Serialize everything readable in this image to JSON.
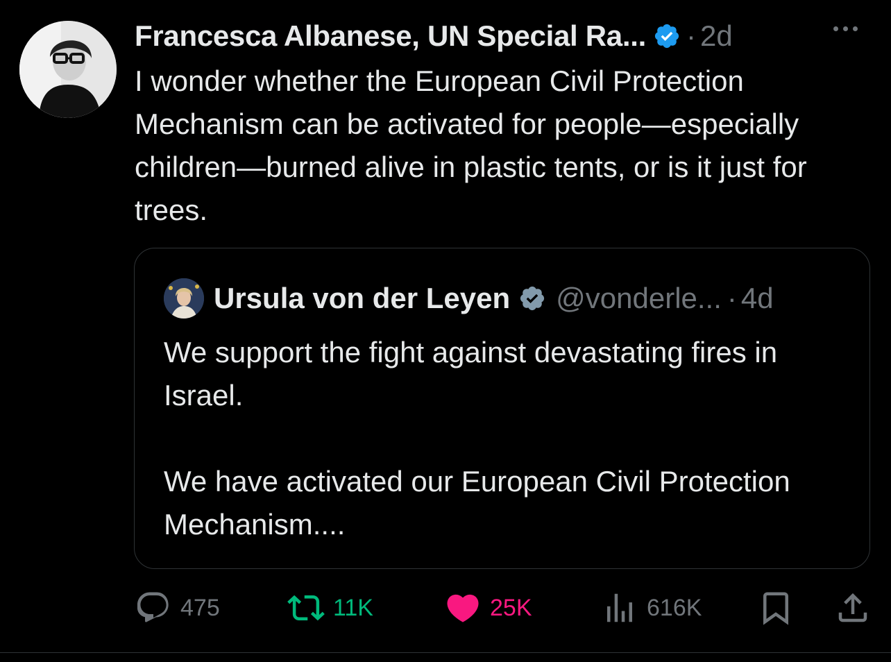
{
  "tweet": {
    "author_name": "Francesca Albanese, UN Special Ra...",
    "separator": "·",
    "time": "2d",
    "avatar_icon": "profile-photo",
    "text": "I wonder whether the European Civil Protection Mechanism can be activated for people—especially children—burned alive in plastic tents, or is it just for trees."
  },
  "quote": {
    "author_name": "Ursula von der Leyen",
    "handle": "@vonderle...",
    "separator": "·",
    "time": "4d",
    "paragraphs": [
      "We support the fight against devastating fires in Israel.",
      "We have activated our European Civil Protection Mechanism...."
    ]
  },
  "actions": {
    "replies": "475",
    "reposts": "11K",
    "likes": "25K",
    "views": "616K"
  },
  "colors": {
    "background": "#000000",
    "text": "#e7e9ea",
    "muted": "#71767b",
    "border": "#2f3336",
    "verified_blue": "#1d9bf0",
    "verified_gray": "#829aab",
    "repost_green": "#00ba7c",
    "like_pink": "#f91880"
  }
}
